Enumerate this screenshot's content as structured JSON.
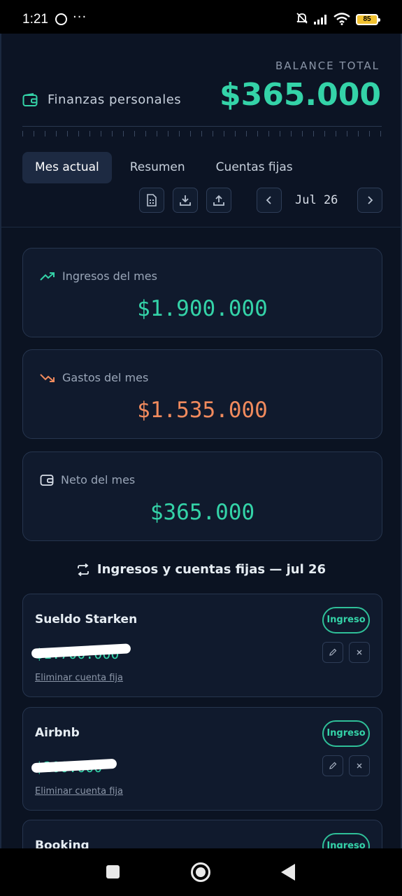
{
  "status_bar": {
    "time": "1:21",
    "more": "···",
    "battery": "85"
  },
  "header": {
    "app_title": "Finanzas personales",
    "balance_label": "BALANCE TOTAL",
    "balance_value": "$365.000"
  },
  "tabs": [
    {
      "label": "Mes actual",
      "active": true
    },
    {
      "label": "Resumen",
      "active": false
    },
    {
      "label": "Cuentas fijas",
      "active": false
    }
  ],
  "toolbar": {
    "month": "Jul 26"
  },
  "stats": {
    "income": {
      "label": "Ingresos del mes",
      "value": "$1.900.000",
      "color": "#34d3a8"
    },
    "expenses": {
      "label": "Gastos del mes",
      "value": "$1.535.000",
      "color": "#f08a5d"
    },
    "net": {
      "label": "Neto del mes",
      "value": "$365.000",
      "color": "#34d3a8"
    }
  },
  "section": {
    "title": "Ingresos y cuentas fijas — jul 26"
  },
  "items": [
    {
      "name": "Sueldo Starken",
      "badge": "Ingreso",
      "amount": "$1.700.000",
      "delete_label": "Eliminar cuenta fija"
    },
    {
      "name": "Airbnb",
      "badge": "Ingreso",
      "amount": "$200.000",
      "delete_label": "Eliminar cuenta fija"
    },
    {
      "name": "Booking",
      "badge": "Ingreso"
    }
  ],
  "colors": {
    "accent": "#34d3a8",
    "expense": "#f08a5d",
    "background": "#0b1322",
    "card": "#101a2d"
  }
}
